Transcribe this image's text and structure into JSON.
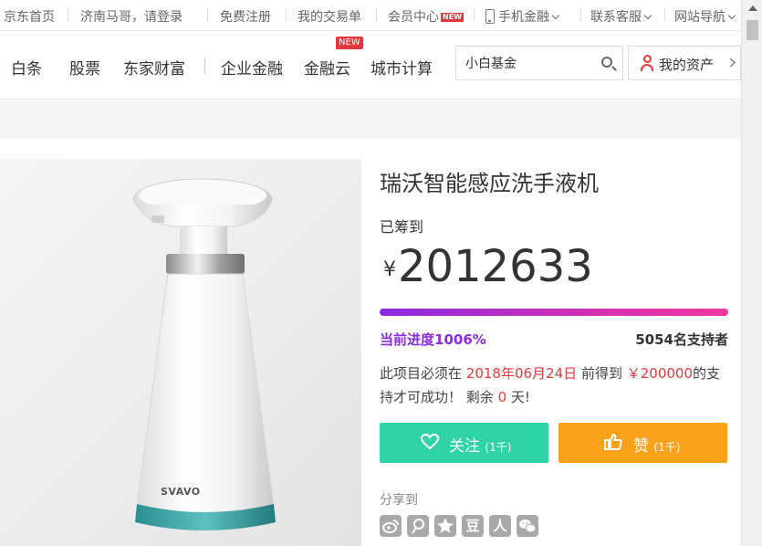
{
  "topbar": {
    "home": "京东首页",
    "greeting": "济南马哥，请登录",
    "register": "免费注册",
    "my_trades": "我的交易单",
    "member_center": "会员中心",
    "member_badge": "NEW",
    "mobile_finance": "手机金融",
    "contact": "联系客服",
    "site_nav": "网站导航"
  },
  "nav": {
    "items": [
      "白条",
      "股票",
      "东家财富",
      "企业金融",
      "金融云",
      "城市计算"
    ],
    "cloud_badge": "NEW",
    "search_value": "小白基金",
    "my_assets": "我的资产"
  },
  "product": {
    "image_brand": "SVAVO",
    "title": "瑞沃智能感应洗手液机",
    "raised_label": "已筹到",
    "currency": "¥",
    "amount": "2012633",
    "progress_label": "当前进度",
    "progress_value": "1006%",
    "progress_percent": 1006,
    "supporters": "5054名支持者",
    "deadline_prefix": "此项目必须在",
    "deadline_date": "2018年06月24日",
    "deadline_mid": "前得到",
    "target_amount": "￥200000",
    "deadline_mid2": "的支持才可成功！ 剩余",
    "days_left": "0",
    "deadline_suffix": "天!"
  },
  "actions": {
    "follow_label": "关注",
    "follow_count": "(1千)",
    "like_label": "赞",
    "like_count": "(1千)"
  },
  "share": {
    "label": "分享到",
    "icons": [
      "weibo-icon",
      "tencent-weibo-icon",
      "qzone-icon",
      "douban-icon",
      "renren-icon",
      "wechat-icon"
    ],
    "douban_glyph": "豆",
    "renren_glyph": "人"
  },
  "colors": {
    "accent_red": "#e4393c",
    "progress_purple": "#8a2be2",
    "follow_green": "#2fd3a4",
    "like_orange": "#fba21d"
  }
}
